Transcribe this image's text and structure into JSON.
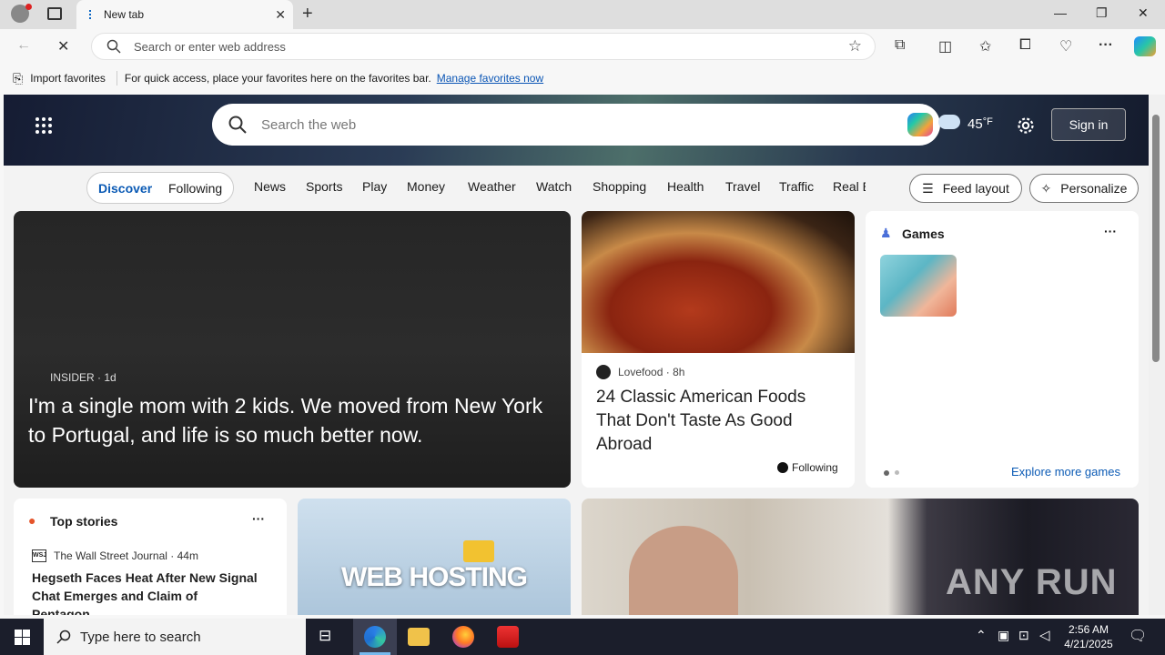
{
  "browser": {
    "tab_title": "New tab",
    "address_placeholder": "Search or enter web address"
  },
  "favbar": {
    "import_label": "Import favorites",
    "message": "For quick access, place your favorites here on the favorites bar.",
    "manage_link": "Manage favorites now"
  },
  "hero": {
    "search_placeholder": "Search the web",
    "weather_temp": "45",
    "weather_unit": "°F",
    "sign_in": "Sign in"
  },
  "categories": {
    "discover": "Discover",
    "following": "Following",
    "items": [
      "News",
      "Sports",
      "Play",
      "Money",
      "Weather",
      "Watch",
      "Shopping",
      "Health",
      "Travel",
      "Traffic",
      "Real E"
    ],
    "feed_layout": "Feed layout",
    "personalize": "Personalize"
  },
  "main_story": {
    "source": "INSIDER",
    "age": "· 1d",
    "headline": "I'm a single mom with 2 kids. We moved from New York to Portugal, and life is so much better now."
  },
  "food_story": {
    "source": "Lovefood",
    "age": "· 8h",
    "headline": "24 Classic American Foods That Don't Taste As Good Abroad",
    "following": "Following"
  },
  "games": {
    "title": "Games",
    "more": "···",
    "explore": "Explore more games"
  },
  "top_stories": {
    "title": "Top stories",
    "more": "···",
    "source": "The Wall Street Journal",
    "source_abbr": "WSJ",
    "age": "· 44m",
    "headline": "Hegseth Faces Heat After New Signal Chat Emerges and Claim of Pentagon…"
  },
  "hosting_card": {
    "text": "WEB HOSTING"
  },
  "watermark": {
    "text": "ANY RUN"
  },
  "taskbar": {
    "search_placeholder": "Type here to search",
    "time": "2:56 AM",
    "date": "4/21/2025"
  }
}
